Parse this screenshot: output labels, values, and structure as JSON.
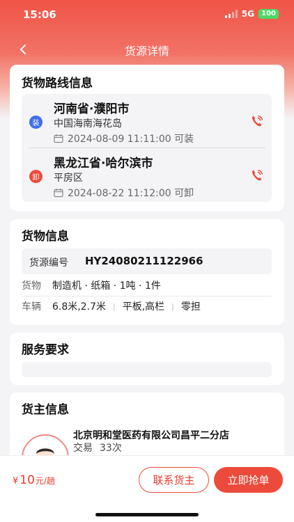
{
  "status": {
    "time": "15:06",
    "network": "5G",
    "battery": "100"
  },
  "nav": {
    "title": "货源详情"
  },
  "route": {
    "title": "货物路线信息",
    "stops": [
      {
        "badge": "装",
        "city": "河南省·濮阳市",
        "address": "中国海南海花岛",
        "time": "2024-08-09 11:11:00 可装"
      },
      {
        "badge": "卸",
        "city": "黑龙江省·哈尔滨市",
        "address": "平房区",
        "time": "2024-08-22 11:12:00 可卸"
      }
    ]
  },
  "goods": {
    "title": "货物信息",
    "code_label": "货源编号",
    "code_value": "HY24080211122966",
    "cargo_label": "货物",
    "cargo_value": "制造机 · 纸箱 · 1吨 · 1件",
    "vehicle_label": "车辆",
    "vehicle_size": "6.8米,2.7米",
    "vehicle_type": "平板,高栏",
    "vehicle_load": "零担"
  },
  "service": {
    "title": "服务要求"
  },
  "shipper": {
    "title": "货主信息",
    "company": "北京明和堂医药有限公司昌平二分店",
    "trade_label": "交易",
    "trade_count": "33次"
  },
  "bottom": {
    "price_symbol": "¥",
    "price_value": "10",
    "price_unit": "元/趟",
    "contact_label": "联系货主",
    "grab_label": "立即抢单"
  },
  "colors": {
    "accent": "#ec4b3c",
    "load_badge": "#3f6ff0"
  }
}
